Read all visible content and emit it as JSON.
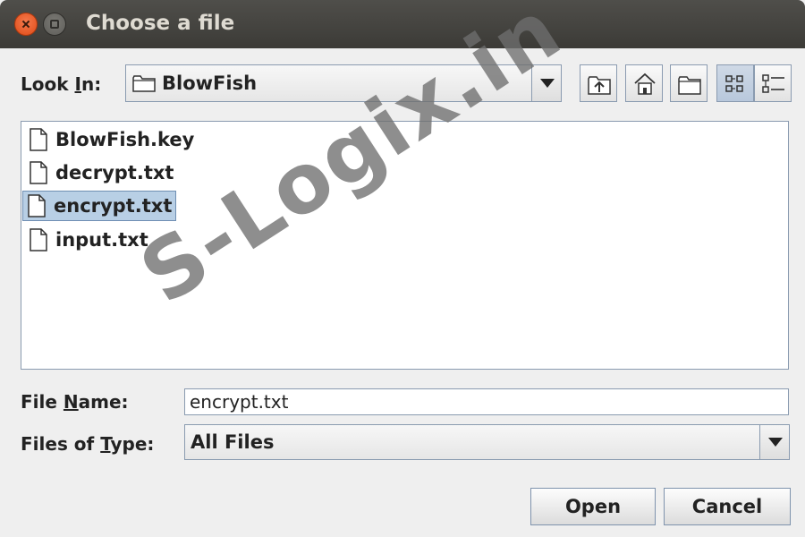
{
  "window": {
    "title": "Choose a file"
  },
  "look_in": {
    "label_pre": "Look ",
    "label_key": "I",
    "label_post": "n:",
    "value": "BlowFish"
  },
  "toolbar": {
    "buttons": [
      "up-one-level-icon",
      "home-icon",
      "new-folder-icon",
      "list-view-icon",
      "details-view-icon"
    ]
  },
  "files": [
    {
      "name": "BlowFish.key",
      "selected": false
    },
    {
      "name": "decrypt.txt",
      "selected": false
    },
    {
      "name": "encrypt.txt",
      "selected": true
    },
    {
      "name": "input.txt",
      "selected": false
    }
  ],
  "file_name": {
    "label_pre": "File ",
    "label_key": "N",
    "label_post": "ame:",
    "value": "encrypt.txt"
  },
  "file_type": {
    "label_pre": "Files of ",
    "label_key": "T",
    "label_post": "ype:",
    "value": "All Files"
  },
  "actions": {
    "open": "Open",
    "cancel": "Cancel"
  },
  "watermark": "S-Logix.in",
  "colors": {
    "titlebar": "#3c3b37",
    "close_button": "#df4a16",
    "selection": "#b8cfe5",
    "border": "#8a9bb0"
  }
}
